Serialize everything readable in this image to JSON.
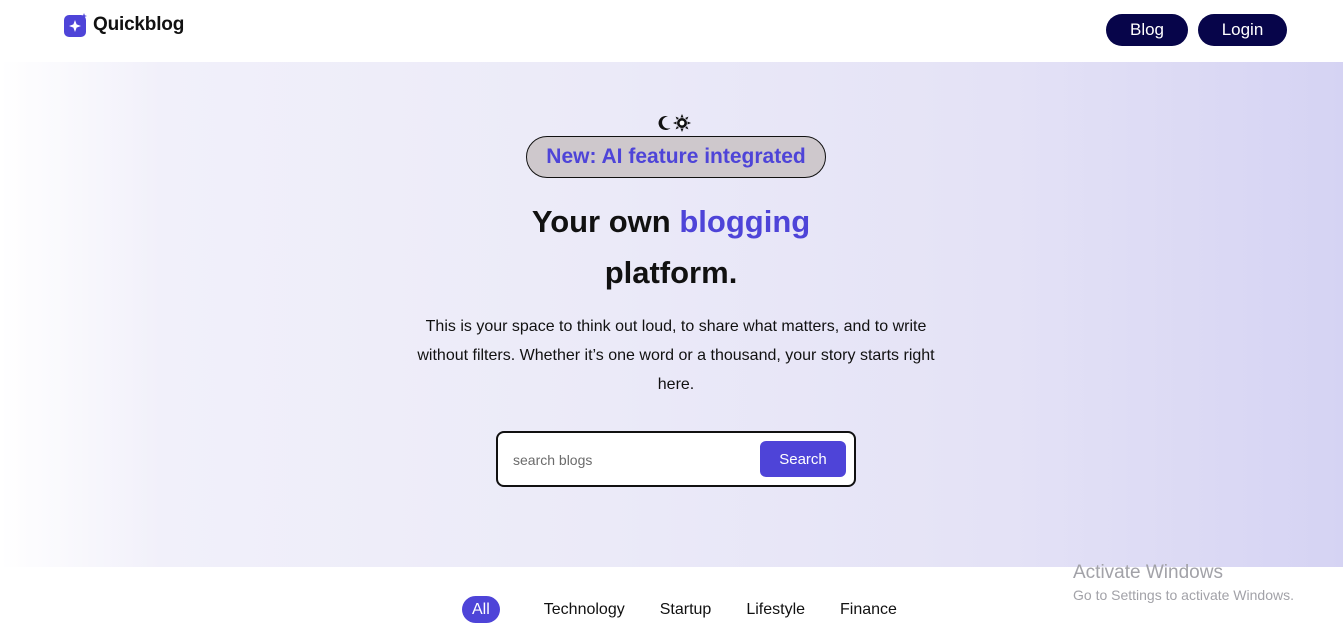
{
  "header": {
    "logo_text": "Quickblog",
    "nav": {
      "blog_label": "Blog",
      "login_label": "Login"
    }
  },
  "hero": {
    "theme_icons": [
      "moon-icon",
      "sun-icon"
    ],
    "badge_text": "New: AI feature integrated",
    "headline": {
      "part1": "Your own ",
      "accent": "blogging",
      "part2": "platform."
    },
    "subtext": "This is your space to think out loud, to share what matters, and to write without filters. Whether it’s one word or a thousand, your story starts right here.",
    "search": {
      "placeholder": "search blogs",
      "value": "",
      "button_label": "Search"
    }
  },
  "categories": {
    "items": [
      "All",
      "Technology",
      "Startup",
      "Lifestyle",
      "Finance"
    ],
    "active": "All"
  },
  "watermark": {
    "title": "Activate Windows",
    "subtitle": "Go to Settings to activate Windows."
  },
  "colors": {
    "accent": "#4e44d8",
    "nav_button": "#07054a",
    "badge_bg": "#cec8cc"
  }
}
